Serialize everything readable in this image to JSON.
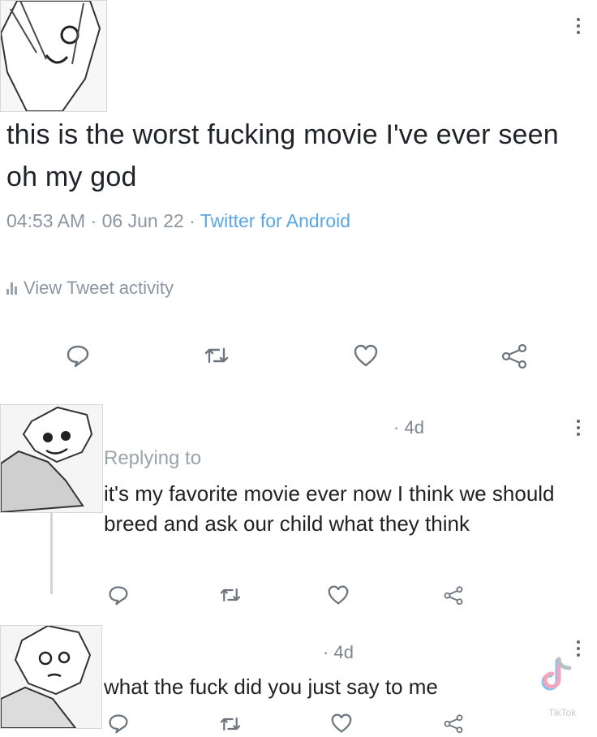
{
  "tweet": {
    "text": "this is the worst fucking movie I've ever seen oh my god",
    "time": "04:53 AM",
    "date": "06 Jun 22",
    "client": "Twitter for Android",
    "activity": "View Tweet activity"
  },
  "replies": [
    {
      "time": "4d",
      "replying_to": "Replying to",
      "text": "it's my favorite movie ever now I think we should breed and ask our child what they think"
    },
    {
      "time": "4d",
      "text": "what the fuck did you just say to me"
    }
  ],
  "watermark": "TikTok",
  "icons": [
    "reply-icon",
    "retweet-icon",
    "like-icon",
    "share-icon",
    "more-icon",
    "tiktok-logo-icon"
  ],
  "colors": {
    "link": "#5aa6e6",
    "meta": "#8d96a0",
    "text": "#1f2328",
    "thread": "#cfd5db"
  }
}
